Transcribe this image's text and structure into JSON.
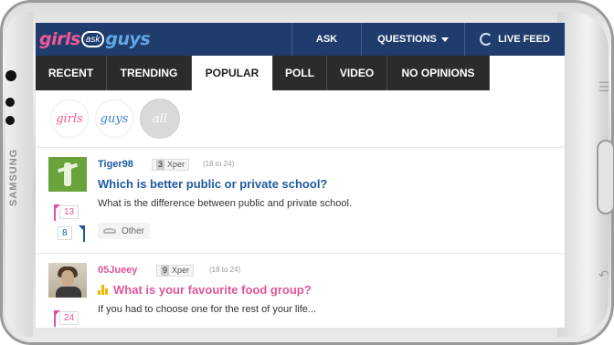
{
  "phone": {
    "brand": "SAMSUNG"
  },
  "header": {
    "logo": {
      "part1": "girls",
      "part2": "ask",
      "part3": "guys"
    },
    "nav": {
      "ask": "ASK",
      "questions": "QUESTIONS",
      "live_feed": "LIVE FEED"
    },
    "colors": {
      "bar": "#1f3c6d",
      "girls_pink": "#ee5a95",
      "guys_blue": "#62a6e3"
    }
  },
  "tabs": [
    {
      "label": "RECENT",
      "active": false
    },
    {
      "label": "TRENDING",
      "active": false
    },
    {
      "label": "POPULAR",
      "active": true
    },
    {
      "label": "POLL",
      "active": false
    },
    {
      "label": "VIDEO",
      "active": false
    },
    {
      "label": "NO OPINIONS",
      "active": false
    }
  ],
  "filters": [
    {
      "label": "girls",
      "selected": false
    },
    {
      "label": "guys",
      "selected": false
    },
    {
      "label": "all",
      "selected": true
    }
  ],
  "posts": [
    {
      "username": "Tiger98",
      "xper_level": "3",
      "xper_label": "Xper",
      "age_range": "(18 to 24)",
      "title": "Which is better public or private school?",
      "description": "What is the difference between public and private school.",
      "girls_votes": "13",
      "guys_votes": "8",
      "category": "Other",
      "is_poll": false
    },
    {
      "username": "05Jueey",
      "xper_level": "9",
      "xper_label": "Xper",
      "age_range": "(18 to 24)",
      "title": "What is your favourite food group?",
      "description": "If you had to choose one for the rest of your life...",
      "girls_votes": "24",
      "is_poll": true
    }
  ]
}
